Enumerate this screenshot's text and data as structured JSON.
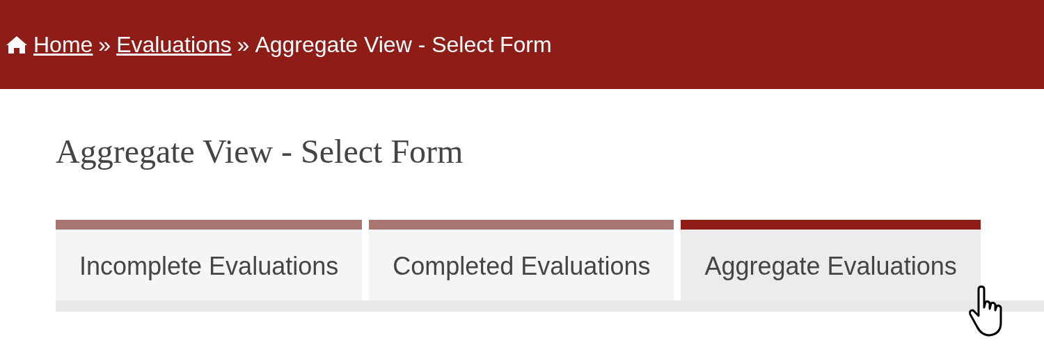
{
  "breadcrumb": {
    "items": [
      {
        "kind": "link",
        "label": "Home"
      },
      {
        "kind": "separator",
        "label": "»"
      },
      {
        "kind": "link",
        "label": "Evaluations"
      },
      {
        "kind": "separator",
        "label": "»"
      },
      {
        "kind": "current",
        "label": "Aggregate View - Select Form"
      }
    ]
  },
  "title": "Aggregate View - Select Form",
  "tabs": [
    {
      "label": "Incomplete Evaluations",
      "selected": false
    },
    {
      "label": "Completed Evaluations",
      "selected": false
    },
    {
      "label": "Aggregate Evaluations",
      "selected": true
    }
  ]
}
